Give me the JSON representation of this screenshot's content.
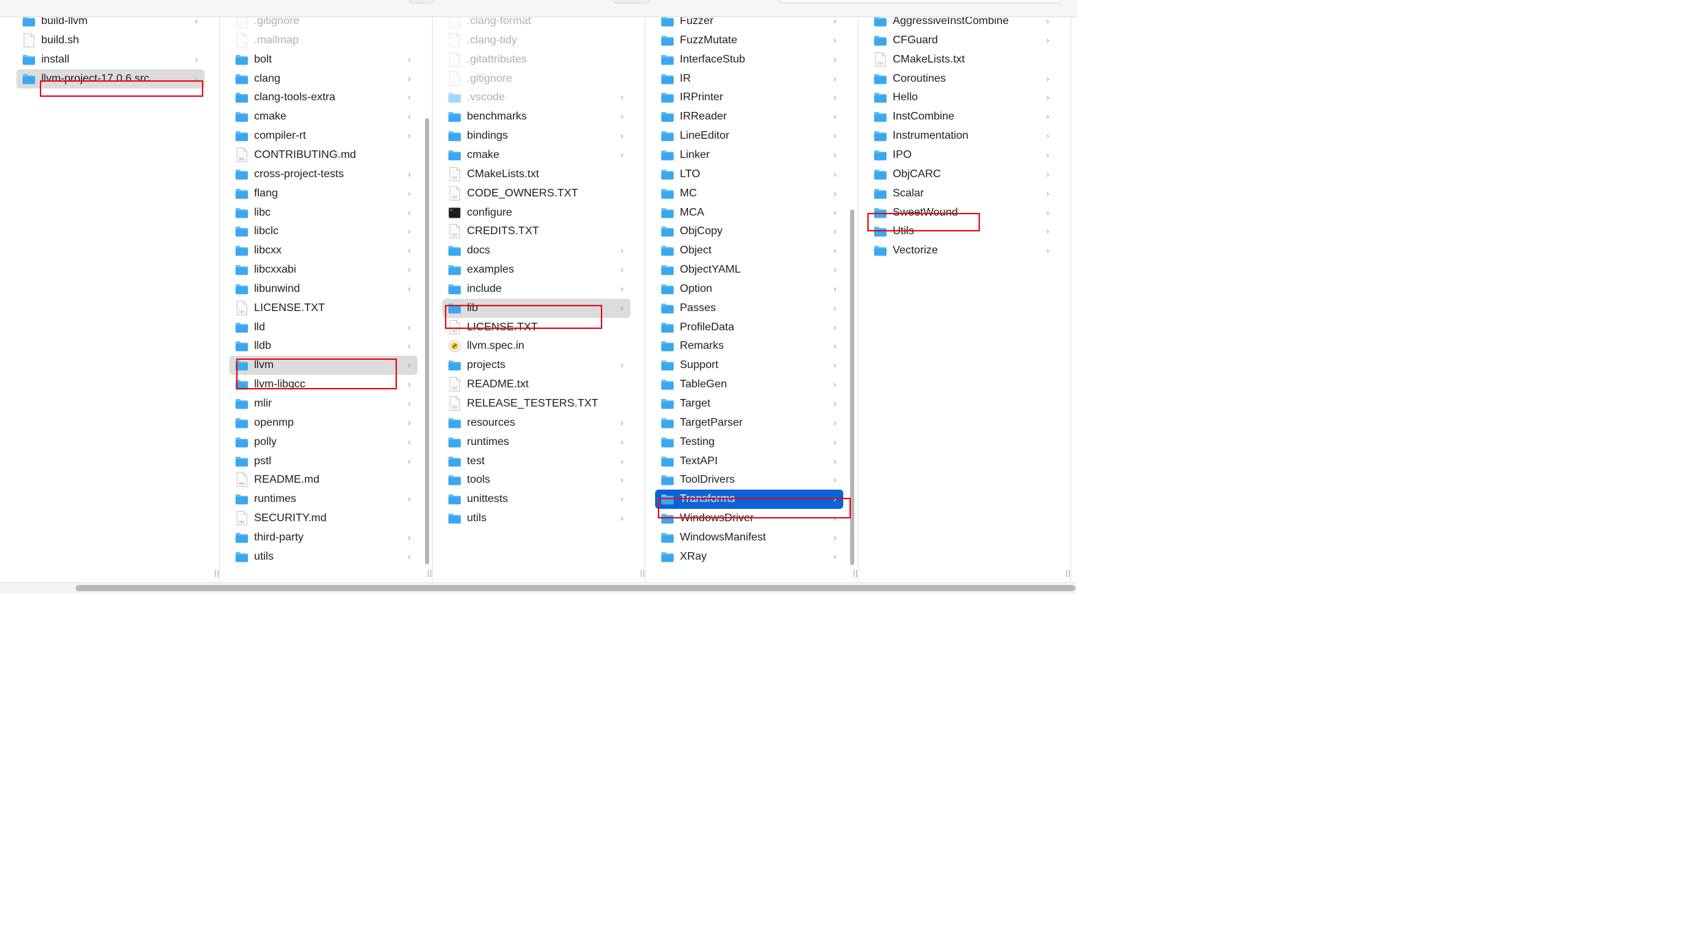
{
  "columns": [
    {
      "items": [
        {
          "name": "build-llvm",
          "kind": "folder",
          "chevron": true
        },
        {
          "name": "build.sh",
          "kind": "file"
        },
        {
          "name": "install",
          "kind": "folder",
          "chevron": true
        },
        {
          "name": "llvm-project-17.0.6.src",
          "kind": "folder",
          "chevron": true,
          "selected": "grey"
        }
      ]
    },
    {
      "items": [
        {
          "name": ".gitignore",
          "kind": "file",
          "dim": true
        },
        {
          "name": ".mailmap",
          "kind": "file",
          "dim": true
        },
        {
          "name": "bolt",
          "kind": "folder",
          "chevron": true
        },
        {
          "name": "clang",
          "kind": "folder",
          "chevron": true
        },
        {
          "name": "clang-tools-extra",
          "kind": "folder",
          "chevron": true
        },
        {
          "name": "cmake",
          "kind": "folder",
          "chevron": true
        },
        {
          "name": "compiler-rt",
          "kind": "folder",
          "chevron": true
        },
        {
          "name": "CONTRIBUTING.md",
          "kind": "md"
        },
        {
          "name": "cross-project-tests",
          "kind": "folder",
          "chevron": true
        },
        {
          "name": "flang",
          "kind": "folder",
          "chevron": true
        },
        {
          "name": "libc",
          "kind": "folder",
          "chevron": true
        },
        {
          "name": "libclc",
          "kind": "folder",
          "chevron": true
        },
        {
          "name": "libcxx",
          "kind": "folder",
          "chevron": true
        },
        {
          "name": "libcxxabi",
          "kind": "folder",
          "chevron": true
        },
        {
          "name": "libunwind",
          "kind": "folder",
          "chevron": true
        },
        {
          "name": "LICENSE.TXT",
          "kind": "txt"
        },
        {
          "name": "lld",
          "kind": "folder",
          "chevron": true
        },
        {
          "name": "lldb",
          "kind": "folder",
          "chevron": true
        },
        {
          "name": "llvm",
          "kind": "folder",
          "chevron": true,
          "selected": "grey"
        },
        {
          "name": "llvm-libgcc",
          "kind": "folder",
          "chevron": true
        },
        {
          "name": "mlir",
          "kind": "folder",
          "chevron": true
        },
        {
          "name": "openmp",
          "kind": "folder",
          "chevron": true
        },
        {
          "name": "polly",
          "kind": "folder",
          "chevron": true
        },
        {
          "name": "pstl",
          "kind": "folder",
          "chevron": true
        },
        {
          "name": "README.md",
          "kind": "md"
        },
        {
          "name": "runtimes",
          "kind": "folder",
          "chevron": true
        },
        {
          "name": "SECURITY.md",
          "kind": "md"
        },
        {
          "name": "third-party",
          "kind": "folder",
          "chevron": true
        },
        {
          "name": "utils",
          "kind": "folder",
          "chevron": true
        }
      ]
    },
    {
      "items": [
        {
          "name": ".clang-format",
          "kind": "file",
          "dim": true
        },
        {
          "name": ".clang-tidy",
          "kind": "file",
          "dim": true
        },
        {
          "name": ".gitattributes",
          "kind": "file",
          "dim": true
        },
        {
          "name": ".gitignore",
          "kind": "file",
          "dim": true
        },
        {
          "name": ".vscode",
          "kind": "folder",
          "dim": true,
          "chevron": true
        },
        {
          "name": "benchmarks",
          "kind": "folder",
          "chevron": true
        },
        {
          "name": "bindings",
          "kind": "folder",
          "chevron": true
        },
        {
          "name": "cmake",
          "kind": "folder",
          "chevron": true
        },
        {
          "name": "CMakeLists.txt",
          "kind": "txt"
        },
        {
          "name": "CODE_OWNERS.TXT",
          "kind": "txt"
        },
        {
          "name": "configure",
          "kind": "exec"
        },
        {
          "name": "CREDITS.TXT",
          "kind": "txt"
        },
        {
          "name": "docs",
          "kind": "folder",
          "chevron": true
        },
        {
          "name": "examples",
          "kind": "folder",
          "chevron": true
        },
        {
          "name": "include",
          "kind": "folder",
          "chevron": true
        },
        {
          "name": "lib",
          "kind": "folder",
          "chevron": true,
          "selected": "grey"
        },
        {
          "name": "LICENSE.TXT",
          "kind": "txt"
        },
        {
          "name": "llvm.spec.in",
          "kind": "spec"
        },
        {
          "name": "projects",
          "kind": "folder",
          "chevron": true
        },
        {
          "name": "README.txt",
          "kind": "txt"
        },
        {
          "name": "RELEASE_TESTERS.TXT",
          "kind": "txt"
        },
        {
          "name": "resources",
          "kind": "folder",
          "chevron": true
        },
        {
          "name": "runtimes",
          "kind": "folder",
          "chevron": true
        },
        {
          "name": "test",
          "kind": "folder",
          "chevron": true
        },
        {
          "name": "tools",
          "kind": "folder",
          "chevron": true
        },
        {
          "name": "unittests",
          "kind": "folder",
          "chevron": true
        },
        {
          "name": "utils",
          "kind": "folder",
          "chevron": true
        }
      ]
    },
    {
      "items": [
        {
          "name": "Fuzzer",
          "kind": "folder",
          "chevron": true
        },
        {
          "name": "FuzzMutate",
          "kind": "folder",
          "chevron": true
        },
        {
          "name": "InterfaceStub",
          "kind": "folder",
          "chevron": true
        },
        {
          "name": "IR",
          "kind": "folder",
          "chevron": true
        },
        {
          "name": "IRPrinter",
          "kind": "folder",
          "chevron": true
        },
        {
          "name": "IRReader",
          "kind": "folder",
          "chevron": true
        },
        {
          "name": "LineEditor",
          "kind": "folder",
          "chevron": true
        },
        {
          "name": "Linker",
          "kind": "folder",
          "chevron": true
        },
        {
          "name": "LTO",
          "kind": "folder",
          "chevron": true
        },
        {
          "name": "MC",
          "kind": "folder",
          "chevron": true
        },
        {
          "name": "MCA",
          "kind": "folder",
          "chevron": true
        },
        {
          "name": "ObjCopy",
          "kind": "folder",
          "chevron": true
        },
        {
          "name": "Object",
          "kind": "folder",
          "chevron": true
        },
        {
          "name": "ObjectYAML",
          "kind": "folder",
          "chevron": true
        },
        {
          "name": "Option",
          "kind": "folder",
          "chevron": true
        },
        {
          "name": "Passes",
          "kind": "folder",
          "chevron": true
        },
        {
          "name": "ProfileData",
          "kind": "folder",
          "chevron": true
        },
        {
          "name": "Remarks",
          "kind": "folder",
          "chevron": true
        },
        {
          "name": "Support",
          "kind": "folder",
          "chevron": true
        },
        {
          "name": "TableGen",
          "kind": "folder",
          "chevron": true
        },
        {
          "name": "Target",
          "kind": "folder",
          "chevron": true
        },
        {
          "name": "TargetParser",
          "kind": "folder",
          "chevron": true
        },
        {
          "name": "Testing",
          "kind": "folder",
          "chevron": true
        },
        {
          "name": "TextAPI",
          "kind": "folder",
          "chevron": true
        },
        {
          "name": "ToolDrivers",
          "kind": "folder",
          "chevron": true
        },
        {
          "name": "Transforms",
          "kind": "folder",
          "chevron": true,
          "selected": "blue"
        },
        {
          "name": "WindowsDriver",
          "kind": "folder",
          "chevron": true
        },
        {
          "name": "WindowsManifest",
          "kind": "folder",
          "chevron": true
        },
        {
          "name": "XRay",
          "kind": "folder",
          "chevron": true
        }
      ]
    },
    {
      "items": [
        {
          "name": "AggressiveInstCombine",
          "kind": "folder",
          "chevron": true
        },
        {
          "name": "CFGuard",
          "kind": "folder",
          "chevron": true
        },
        {
          "name": "CMakeLists.txt",
          "kind": "txt"
        },
        {
          "name": "Coroutines",
          "kind": "folder",
          "chevron": true
        },
        {
          "name": "Hello",
          "kind": "folder",
          "chevron": true
        },
        {
          "name": "InstCombine",
          "kind": "folder",
          "chevron": true
        },
        {
          "name": "Instrumentation",
          "kind": "folder",
          "chevron": true
        },
        {
          "name": "IPO",
          "kind": "folder",
          "chevron": true
        },
        {
          "name": "ObjCARC",
          "kind": "folder",
          "chevron": true
        },
        {
          "name": "Scalar",
          "kind": "folder",
          "chevron": true
        },
        {
          "name": "SweetWound",
          "kind": "folder",
          "chevron": true
        },
        {
          "name": "Utils",
          "kind": "folder",
          "chevron": true
        },
        {
          "name": "Vectorize",
          "kind": "folder",
          "chevron": true
        }
      ]
    }
  ],
  "icon_labels": {
    "txt": "TXT",
    "md": "MD"
  },
  "resize_glyph": "||",
  "colors": {
    "folder": "#3aa7ef",
    "folder_tab": "#62bff7",
    "selection_blue": "#0a63d8",
    "selection_grey": "#dcdcdc",
    "annotation_red": "#e30f1b"
  }
}
